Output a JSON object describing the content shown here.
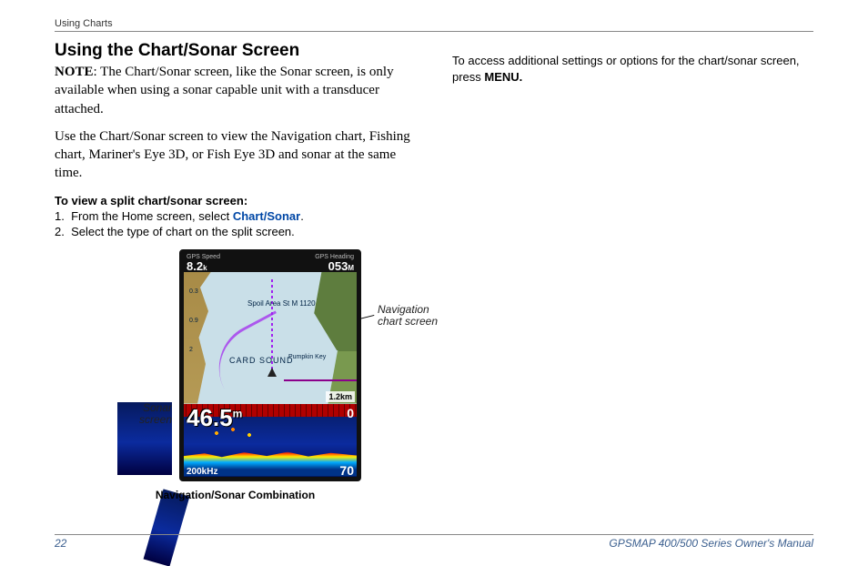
{
  "header": {
    "section": "Using Charts"
  },
  "title": "Using the Chart/Sonar Screen",
  "note": {
    "label": "NOTE",
    "text": ": The Chart/Sonar screen, like the Sonar screen, is only available when using a sonar capable unit with a transducer attached."
  },
  "intro": "Use the Chart/Sonar screen to view the Navigation chart, Fishing chart, Mariner's Eye 3D, or Fish Eye 3D and sonar at the same time.",
  "steps": {
    "heading": "To view a split chart/sonar screen:",
    "items": [
      {
        "num": "1.",
        "pre": "From the Home screen, select ",
        "menu": "Chart/Sonar",
        "post": "."
      },
      {
        "num": "2.",
        "pre": "Select the type of chart on the split screen.",
        "menu": "",
        "post": ""
      }
    ]
  },
  "right": {
    "line1": "To access additional settings or options for the chart/sonar screen, press ",
    "menu": "MENU."
  },
  "figure": {
    "callouts": {
      "nav": "Navigation chart screen",
      "sonar": "Sonar screen"
    },
    "status": {
      "left_label": "GPS Speed",
      "left_val": "8.2",
      "left_unit": "k",
      "right_label": "GPS Heading",
      "right_val": "053",
      "right_unit": "M"
    },
    "nav": {
      "spoil": "Spoil Area\nSt M 1120",
      "sound": "CARD SOUND",
      "pumpkin": "Pumpkin Key",
      "s1": "0.3",
      "s2": "0.9",
      "s3": "2",
      "scale": "1.2km"
    },
    "sonar": {
      "depth": "46.5",
      "unit": "m",
      "top": "0",
      "max": "70",
      "freq": "200kHz"
    },
    "caption": "Navigation/Sonar Combination"
  },
  "footer": {
    "page": "22",
    "manual": "GPSMAP 400/500 Series Owner's Manual"
  }
}
